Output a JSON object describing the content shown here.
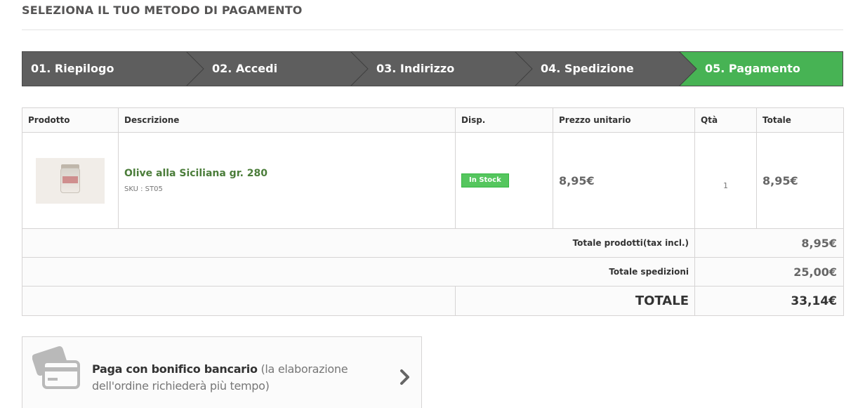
{
  "page": {
    "title": "SELEZIONA IL TUO METODO DI PAGAMENTO"
  },
  "steps": [
    {
      "label": "01. Riepilogo",
      "state": "done"
    },
    {
      "label": "02. Accedi",
      "state": "done"
    },
    {
      "label": "03. Indirizzo",
      "state": "done"
    },
    {
      "label": "04. Spedizione",
      "state": "done"
    },
    {
      "label": "05. Pagamento",
      "state": "current"
    }
  ],
  "colors": {
    "step_default": "#5e5e5e",
    "step_current": "#47b354",
    "link_green": "#4b7d3a",
    "badge_green": "#55c65e"
  },
  "cart": {
    "headers": [
      "Prodotto",
      "Descrizione",
      "Disp.",
      "Prezzo unitario",
      "Qtà",
      "Totale"
    ],
    "item": {
      "image_icon": "product-jar-image",
      "name": "Olive alla Siciliana gr. 280",
      "sku": "SKU : ST05",
      "availability": "In Stock",
      "unit_price": "8,95€",
      "qty": "1",
      "total": "8,95€"
    },
    "summary": {
      "products_label": "Totale prodotti(tax incl.)",
      "products_value": "8,95€",
      "shipping_label": "Totale spedizioni",
      "shipping_value": "25,00€",
      "total_label": "TOTALE",
      "total_value": "33,14€"
    }
  },
  "payment": {
    "icon": "credit-card-icon",
    "title": "Paga con bonifico bancario",
    "note": "(la elaborazione dell'ordine richiederà più tempo)",
    "arrow_icon": "chevron-right-icon"
  }
}
